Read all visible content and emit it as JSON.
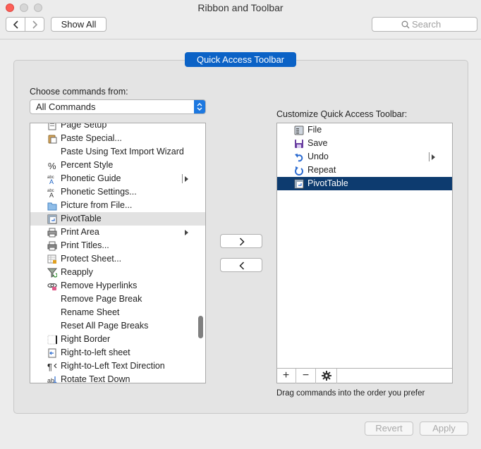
{
  "window": {
    "title": "Ribbon and Toolbar"
  },
  "toolbar": {
    "show_all": "Show All",
    "search_placeholder": "Search"
  },
  "group": {
    "title": "Quick Access Toolbar"
  },
  "left": {
    "label": "Choose commands from:",
    "selected": "All Commands",
    "items": [
      {
        "label": "Page Setup",
        "icon": "page-setup-icon",
        "state": ""
      },
      {
        "label": "Paste Special...",
        "icon": "paste-special-icon",
        "state": ""
      },
      {
        "label": "Paste Using Text Import Wizard",
        "icon": "",
        "state": ""
      },
      {
        "label": "Percent Style",
        "icon": "percent-icon",
        "state": ""
      },
      {
        "label": "Phonetic Guide",
        "icon": "phonetic-guide-icon",
        "state": "",
        "submenu": "split"
      },
      {
        "label": "Phonetic Settings...",
        "icon": "phonetic-settings-icon",
        "state": ""
      },
      {
        "label": "Picture from File...",
        "icon": "folder-icon",
        "state": ""
      },
      {
        "label": "PivotTable",
        "icon": "pivottable-icon",
        "state": "hover"
      },
      {
        "label": "Print Area",
        "icon": "print-area-icon",
        "state": "",
        "submenu": "arrow"
      },
      {
        "label": "Print Titles...",
        "icon": "print-titles-icon",
        "state": ""
      },
      {
        "label": "Protect Sheet...",
        "icon": "protect-sheet-icon",
        "state": ""
      },
      {
        "label": "Reapply",
        "icon": "reapply-filter-icon",
        "state": ""
      },
      {
        "label": "Remove Hyperlinks",
        "icon": "remove-hyperlinks-icon",
        "state": ""
      },
      {
        "label": "Remove Page Break",
        "icon": "",
        "state": ""
      },
      {
        "label": "Rename Sheet",
        "icon": "",
        "state": ""
      },
      {
        "label": "Reset All Page Breaks",
        "icon": "",
        "state": ""
      },
      {
        "label": "Right Border",
        "icon": "right-border-icon",
        "state": ""
      },
      {
        "label": "Right-to-left sheet",
        "icon": "right-to-left-sheet-icon",
        "state": ""
      },
      {
        "label": "Right-to-Left Text Direction",
        "icon": "paragraph-icon",
        "state": ""
      },
      {
        "label": "Rotate Text Down",
        "icon": "rotate-text-icon",
        "state": ""
      }
    ]
  },
  "right": {
    "label": "Customize Quick Access Toolbar:",
    "items": [
      {
        "label": "File",
        "icon": "file-icon",
        "state": ""
      },
      {
        "label": "Save",
        "icon": "save-icon",
        "state": ""
      },
      {
        "label": "Undo",
        "icon": "undo-icon",
        "state": "",
        "submenu": "split"
      },
      {
        "label": "Repeat",
        "icon": "repeat-icon",
        "state": ""
      },
      {
        "label": "PivotTable",
        "icon": "pivottable-icon",
        "state": "selected"
      }
    ],
    "footer": {
      "add": "+",
      "remove": "−"
    },
    "hint": "Drag commands into the order you prefer"
  },
  "buttons": {
    "revert": "Revert",
    "apply": "Apply"
  }
}
